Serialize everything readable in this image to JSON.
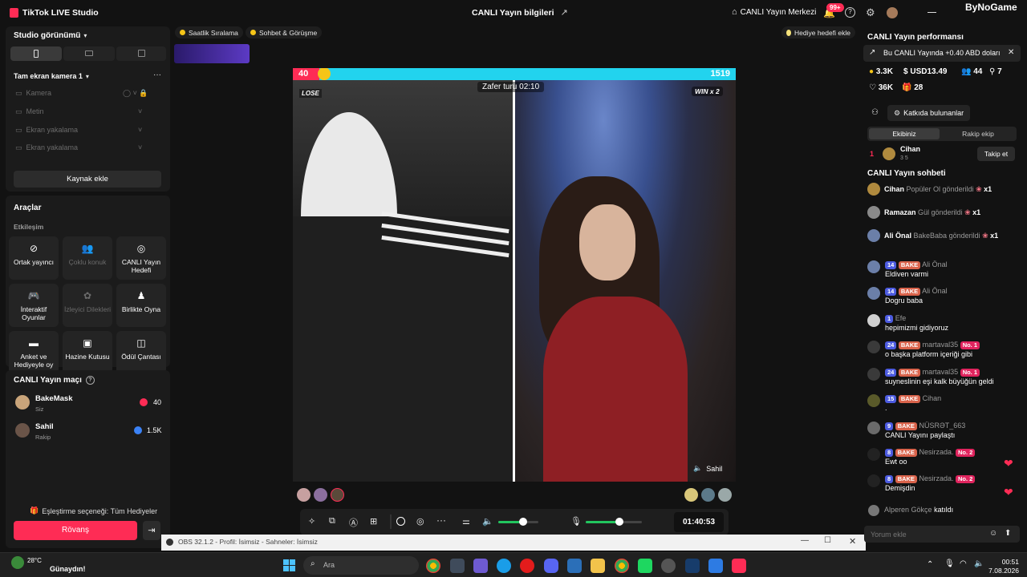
{
  "titlebar": {
    "app_name": "TikTok LIVE Studio",
    "center_title": "CANLI Yayın bilgileri",
    "live_center": "CANLI Yayın Merkezi",
    "notif_badge": "99+",
    "watermark": "ByNoGame"
  },
  "left": {
    "studio_view": "Studio görünümü",
    "scene_name": "Tam ekran kamera 1",
    "sources": [
      "Kamera",
      "Metin",
      "Ekran yakalama",
      "Ekran yakalama"
    ],
    "add_source": "Kaynak ekle",
    "tools_title": "Araçlar",
    "engagement": "Etkileşim",
    "tools": [
      {
        "label": "Ortak yayıncı",
        "icon": "cohost-icon",
        "enabled": true
      },
      {
        "label": "Çoklu konuk",
        "icon": "multi-guest-icon",
        "enabled": false
      },
      {
        "label": "CANLI Yayın Hedefi",
        "icon": "live-goal-icon",
        "enabled": true
      },
      {
        "label": "İnteraktif Oyunlar",
        "icon": "gamepad-icon",
        "enabled": true
      },
      {
        "label": "İzleyici Dilekleri",
        "icon": "viewer-wishes-icon",
        "enabled": false
      },
      {
        "label": "Birlikte Oyna",
        "icon": "play-together-icon",
        "enabled": true
      },
      {
        "label": "Anket ve Hediyeyle oy",
        "icon": "poll-icon",
        "enabled": true
      },
      {
        "label": "Hazine Kutusu",
        "icon": "treasure-box-icon",
        "enabled": true
      },
      {
        "label": "Ödül Çantası",
        "icon": "reward-bag-icon",
        "enabled": true
      }
    ],
    "match_title": "CANLI Yayın maçı",
    "players": [
      {
        "name": "BakeMask",
        "role": "Siz",
        "score": "40"
      },
      {
        "name": "Sahil",
        "role": "Rakip",
        "score": "1.5K"
      }
    ],
    "match_option": "Eşleştirme seçeneği: Tüm Hediyeler",
    "rematch": "Rövanş"
  },
  "top_pills": {
    "hourly_ranking": "Saatlik Sıralama",
    "chat_call": "Sohbet & Görüşme",
    "gift_goal": "Hediye hedefi ekle"
  },
  "stage": {
    "left_score": "40",
    "right_score": "1519",
    "timer": "Zafer turu 02:10",
    "lose_label": "LOSE",
    "win_label": "WIN x 2",
    "opponent_name": "Sahil"
  },
  "controls": {
    "elapsed": "01:40:53",
    "speaker_level": 0.62,
    "mic_level": 0.6
  },
  "right": {
    "perf_title": "CANLI Yayın performansı",
    "earning_banner": "Bu CANLI Yayında +0.40 ABD doları",
    "stats": {
      "coins": "3.3K",
      "usd": "USD13.49",
      "viewers": "44",
      "followers": "7",
      "likes": "36K",
      "gifters": "28"
    },
    "contributors_btn": "Katkıda bulunanlar",
    "tabs": [
      "Ekibiniz",
      "Rakip ekip"
    ],
    "top_contributor": {
      "rank": "1",
      "name": "Cihan",
      "sub": "3  5",
      "follow": "Takip et"
    },
    "chat_title": "CANLI Yayın sohbeti",
    "gifts": [
      {
        "user": "Cihan",
        "text": "Popüler Ol gönderildi",
        "count": "x1"
      },
      {
        "user": "Ramazan",
        "text": "Gül gönderildi",
        "count": "x1"
      },
      {
        "user": "Ali Önal",
        "text": "BakeBaba gönderildi",
        "count": "x1"
      }
    ],
    "messages": [
      {
        "level": "14",
        "fan": "BAKE",
        "user": "Ali Önal",
        "rank": "",
        "text": "Eldiven varmi"
      },
      {
        "level": "14",
        "fan": "BAKE",
        "user": "Ali Önal",
        "rank": "",
        "text": "Dogru baba"
      },
      {
        "level": "1",
        "fan": "",
        "user": "Efe",
        "rank": "",
        "text": "hepimizmi gidiyoruz"
      },
      {
        "level": "24",
        "fan": "BAKE",
        "user": "martaval35",
        "rank": "No. 1",
        "text": "o başka platform içeriği gibi"
      },
      {
        "level": "24",
        "fan": "BAKE",
        "user": "martaval35",
        "rank": "No. 1",
        "text": "suyneslinin eşi kalk büyüğün geldi"
      },
      {
        "level": "15",
        "fan": "BAKE",
        "user": "Cihan",
        "rank": "",
        "text": "."
      },
      {
        "level": "9",
        "fan": "BAKE",
        "user": "NÜSRƏT_663",
        "rank": "",
        "text": "CANLI Yayını paylaştı"
      },
      {
        "level": "8",
        "fan": "BAKE",
        "user": "Nesirzada.",
        "rank": "No. 2",
        "text": "Ewt oo"
      },
      {
        "level": "8",
        "fan": "BAKE",
        "user": "Nesirzada.",
        "rank": "No. 2",
        "text": "Demişdin"
      }
    ],
    "joined": {
      "user": "Alperen Gökçe",
      "text": "katıldı"
    },
    "comment_placeholder": "Yorum ekle"
  },
  "obs_bar": "OBS 32.1.2 - Profil: İsimsiz - Sahneler: İsimsiz",
  "taskbar": {
    "weather_temp": "28°C",
    "greeting": "Günaydın!",
    "search_placeholder": "Ara",
    "time": "00:51",
    "date": "7.08.2026"
  },
  "colors": {
    "accent": "#fe2c55",
    "cyan": "#22d3ee",
    "level_badge": "#4c5be0",
    "fan_badge": "#d9634b"
  }
}
